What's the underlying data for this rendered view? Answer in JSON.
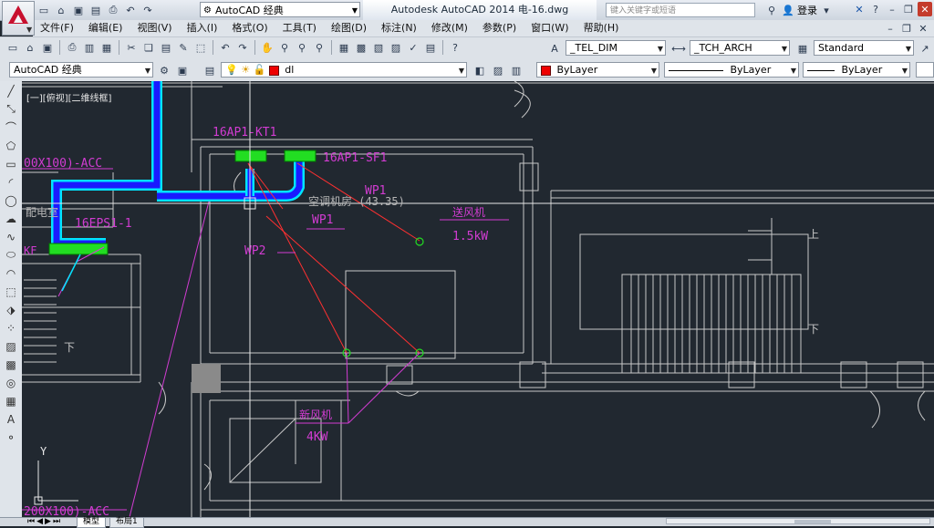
{
  "titlebar": {
    "workspace": "AutoCAD 经典",
    "app_title": "Autodesk AutoCAD 2014    电-16.dwg",
    "search_placeholder": "键入关键字或短语",
    "sign_in": "登录"
  },
  "menu": [
    "文件(F)",
    "编辑(E)",
    "视图(V)",
    "插入(I)",
    "格式(O)",
    "工具(T)",
    "绘图(D)",
    "标注(N)",
    "修改(M)",
    "参数(P)",
    "窗口(W)",
    "帮助(H)"
  ],
  "toolbar": {
    "dim_style": "_TEL_DIM",
    "table_style": "_TCH_ARCH",
    "text_style": "Standard",
    "workspace": "AutoCAD 经典",
    "layer": "dl",
    "color": "ByLayer",
    "linetype": "ByLayer",
    "lineweight": "ByLayer",
    "colors": {
      "layer_swatch": "#e00000"
    }
  },
  "canvas": {
    "view_label": "[一][俯视][二维线框]",
    "labels": {
      "kt": "16AP1-KT1",
      "sf": "16AP1-SF1",
      "acc_top": "00X100)-ACC",
      "room": "空调机房 (43.35)",
      "eps": "16EPS1-1",
      "elec": "配电室",
      "wp1a": "WP1",
      "wp1b": "WP1",
      "wp2": "WP2",
      "fan1_name": "送风机",
      "fan1_power": "1.5kW",
      "fan2_name": "新风机",
      "fan2_power": "4KW",
      "acc_bottom": "200X100)-ACC",
      "kf": "KF",
      "stair_up": "上",
      "stair_down": "下",
      "stair_down2": "下",
      "axis_y": "Y"
    },
    "colors": {
      "background": "#212830",
      "wall": "#c8c8c8",
      "tray": "#1a1aff",
      "tray_edge": "#00e5ff",
      "magenta": "#d23cd2",
      "red": "#ff3030",
      "green": "#22dd22"
    }
  },
  "tabs": {
    "model": "模型",
    "layout1": "布局1"
  }
}
